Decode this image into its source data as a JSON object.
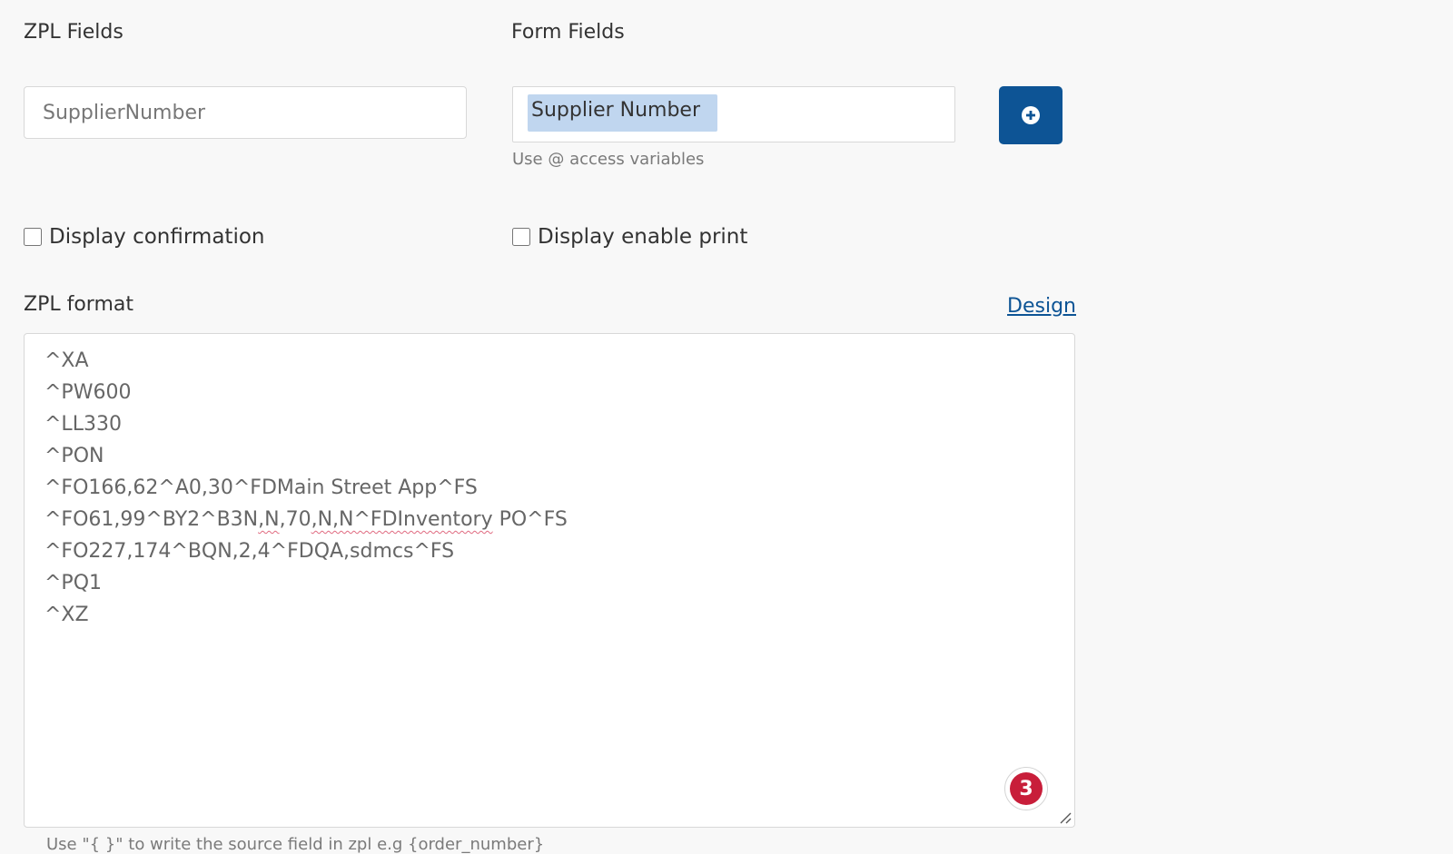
{
  "zpl_fields": {
    "label": "ZPL Fields",
    "placeholder": "SupplierNumber"
  },
  "form_fields": {
    "label": "Form Fields",
    "value": "Supplier Number",
    "hint": "Use @ access variables"
  },
  "add_button": {
    "icon": "plus-circle-icon",
    "color": "#0d5495"
  },
  "checkboxes": {
    "confirmation": {
      "label": "Display confirmation",
      "checked": false
    },
    "enable_print": {
      "label": "Display enable print",
      "checked": false
    }
  },
  "zpl_format": {
    "label": "ZPL format",
    "design_link": "Design",
    "lines": [
      "^XA",
      "^PW600",
      "^LL330",
      "^PON",
      "^FO166,62^A0,30^FDMain Street App^FS",
      "^FO61,99^BY2^B3N,N,70,N,N^FDInventory PO^FS",
      "^FO227,174^BQN,2,4^FDQA,sdmcs^FS",
      "^PQ1",
      "^XZ"
    ],
    "line6_parts": [
      "^FO61,99^BY2^B3N",
      ",N",
      ",70",
      ",N,N^FDInventory",
      " PO^FS"
    ],
    "badge_count": "3",
    "footer_hint": "Use \"{ }\" to write the source field in zpl e.g {order_number}"
  }
}
